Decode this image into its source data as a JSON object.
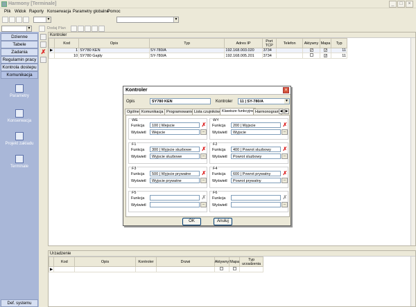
{
  "window": {
    "title": "Harmony [Terminale]",
    "min": "_",
    "max": "□",
    "close": "×"
  },
  "menu": [
    "Plik",
    "Widok",
    "Raporty",
    "Konserwacja",
    "Parametry globalne",
    "Pomoc"
  ],
  "toolbar2": {
    "label": "Dodaj Plan"
  },
  "nav": {
    "items": [
      "Dzienne",
      "Tabele",
      "Zadania",
      "Regulamin pracy",
      "Kontrola dostepu",
      "Komunikacja"
    ],
    "selected": "Komunikacja",
    "big": [
      {
        "label": "Parametry",
        "icon": "parameters-icon"
      },
      {
        "label": "Konserwacja",
        "icon": "maintenance-icon"
      },
      {
        "label": "Projekt zakladu",
        "icon": "plant-project-icon"
      },
      {
        "label": "Terminale",
        "icon": "terminals-icon"
      }
    ],
    "footer": "Def. systemu"
  },
  "kontroler": {
    "title": "Kontroler",
    "columns": [
      "Kod",
      "Opis",
      "Typ",
      "Adres IP",
      "Port TCP",
      "Telefon",
      "Aktywny",
      "Mapa",
      "Typ"
    ],
    "rows": [
      {
        "kod": "1",
        "opis": "SY780 KEN",
        "typ": "SY-780/A",
        "ip": "192.168.003.020",
        "port": "3734",
        "tel": "",
        "aktywny": true,
        "mapa": true,
        "typ2": "11"
      },
      {
        "kod": "10",
        "opis": "SY780 Gajdy",
        "typ": "SY-780/A",
        "ip": "192.168.005.201",
        "port": "3734",
        "tel": "",
        "aktywny": false,
        "mapa": true,
        "typ2": "11"
      }
    ]
  },
  "dialog": {
    "title": "Kontroler",
    "opis_label": "Opis",
    "opis_value": "SY780 KEN",
    "kontroler_label": "Kontroler",
    "kontroler_value": "11  |  SY-780/A",
    "tabs": [
      "Ogólne",
      "Komunikacja",
      "Programowanie",
      "Lista czujników",
      "Klawisze funkcyjne",
      "Harmonogram"
    ],
    "active_tab": "Klawisze funkcyjne",
    "funkcja_label": "Funkcja",
    "wyswietl_label": "Wyświetl",
    "groups": [
      {
        "name": "WE",
        "funkcja": "100  |  Wejscie",
        "wyswietl": "Wejscie"
      },
      {
        "name": "WY",
        "funkcja": "200  |  Wyjscie",
        "wyswietl": "Wyjscie"
      },
      {
        "name": "F1",
        "funkcja": "300  |  Wyjscie sluzbowe",
        "wyswietl": "Wyjscie sluzbowe"
      },
      {
        "name": "F2",
        "funkcja": "400  |  Powrot sluzbowy",
        "wyswietl": "Powrot sluzbowy"
      },
      {
        "name": "F3",
        "funkcja": "500  |  Wyjscie prywatne",
        "wyswietl": "Wyjscie prywatne"
      },
      {
        "name": "F4",
        "funkcja": "600  |  Powrot prywatny",
        "wyswietl": "Powrot prywatny"
      },
      {
        "name": "F5",
        "funkcja": "",
        "wyswietl": ""
      },
      {
        "name": "F6",
        "funkcja": "",
        "wyswietl": ""
      }
    ],
    "ok": "OK",
    "cancel": "Anuluj"
  },
  "urzadzenie": {
    "title": "Urzadzenie",
    "columns": [
      "Kod",
      "Opis",
      "Kontroler",
      "Drzwi",
      "Aktywny",
      "Mapa",
      "Typ urzadzenia"
    ]
  }
}
